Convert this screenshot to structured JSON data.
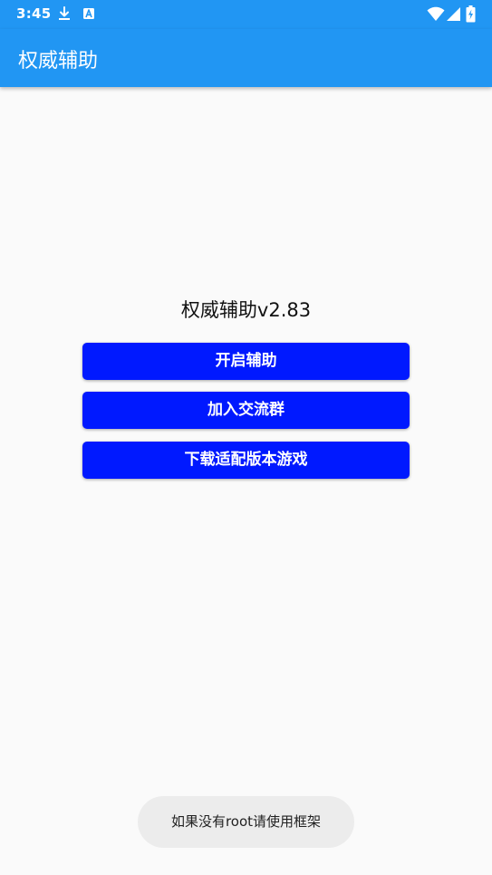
{
  "status_bar": {
    "time": "3:45",
    "left_icons": [
      "download-icon",
      "a-notification-icon"
    ],
    "right_icons": [
      "wifi-icon",
      "signal-icon",
      "battery-icon"
    ],
    "background_color": "#2196f3"
  },
  "app_bar": {
    "title": "权威辅助",
    "background_color": "#2196f3"
  },
  "main": {
    "heading": "权威辅助v2.83",
    "buttons": [
      {
        "label": "开启辅助"
      },
      {
        "label": "加入交流群"
      },
      {
        "label": "下载适配版本游戏"
      }
    ],
    "button_color": "#0019ff"
  },
  "toast": {
    "message": "如果没有root请使用框架"
  }
}
